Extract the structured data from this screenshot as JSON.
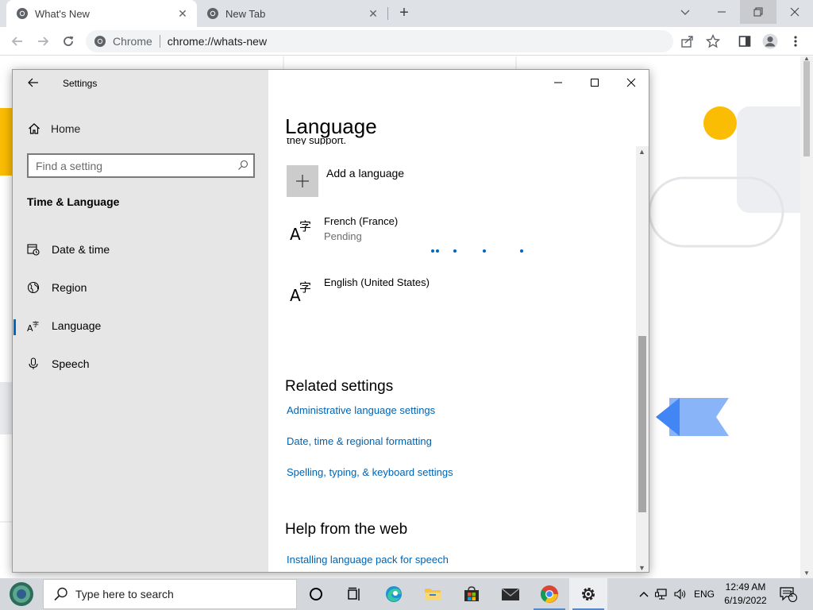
{
  "browser": {
    "tabs": [
      {
        "title": "What's New",
        "active": true
      },
      {
        "title": "New Tab",
        "active": false
      }
    ],
    "omnibox": {
      "chip": "Chrome",
      "url": "chrome://whats-new"
    }
  },
  "settings": {
    "window_title": "Settings",
    "home_label": "Home",
    "search_placeholder": "Find a setting",
    "section": "Time & Language",
    "nav": [
      {
        "label": "Date & time",
        "icon": "calendar-clock-icon",
        "selected": false
      },
      {
        "label": "Region",
        "icon": "globe-icon",
        "selected": false
      },
      {
        "label": "Language",
        "icon": "language-icon",
        "selected": true
      },
      {
        "label": "Speech",
        "icon": "microphone-icon",
        "selected": false
      }
    ],
    "content": {
      "heading": "Language",
      "cut_text": "they support.",
      "add_language": "Add a language",
      "languages": [
        {
          "name": "French (France)",
          "status": "Pending"
        },
        {
          "name": "English (United States)",
          "status": ""
        }
      ],
      "related_heading": "Related settings",
      "related_links": [
        "Administrative language settings",
        "Date, time & regional formatting",
        "Spelling, typing, & keyboard settings"
      ],
      "help_heading": "Help from the web",
      "help_links": [
        "Installing language pack for speech"
      ]
    }
  },
  "taskbar": {
    "search_placeholder": "Type here to search",
    "tray_language": "ENG",
    "time": "12:49 AM",
    "date": "6/19/2022",
    "notification_count": "1"
  },
  "colors": {
    "accent": "#0067c0",
    "link": "#0063b1",
    "sidebar_bg": "#e6e6e6"
  }
}
